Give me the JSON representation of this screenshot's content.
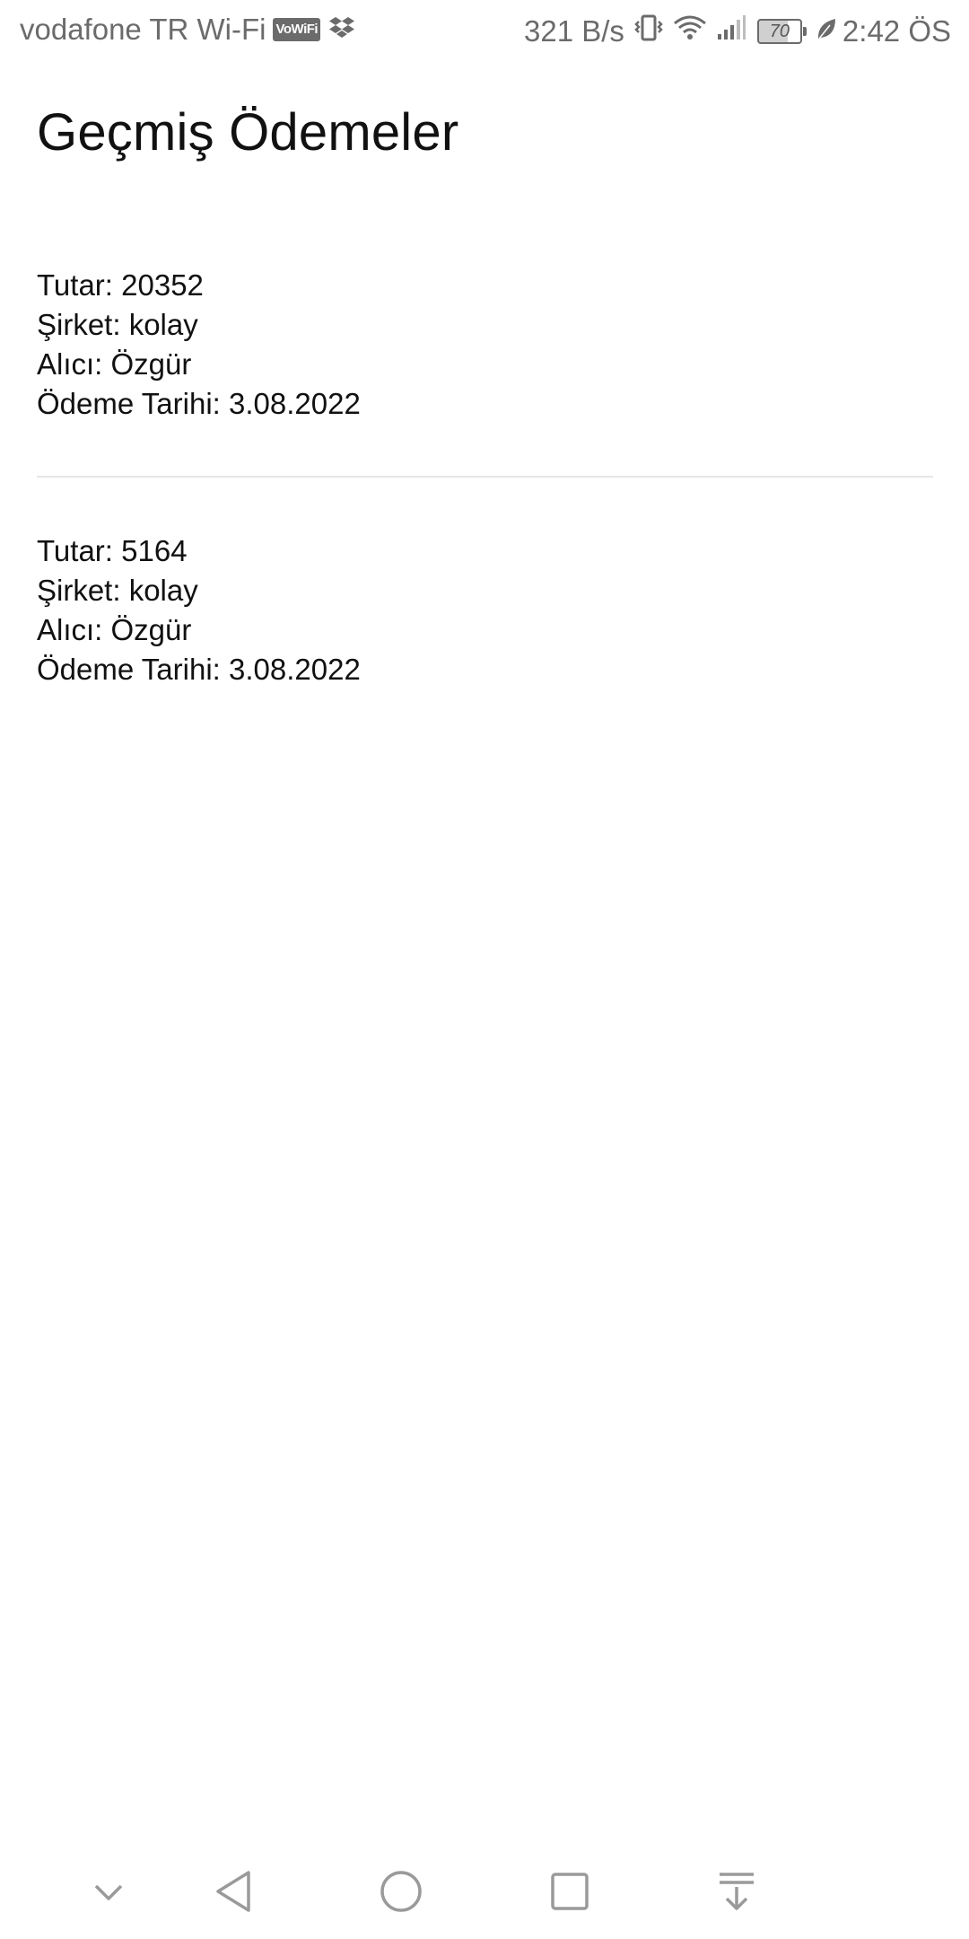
{
  "status_bar": {
    "carrier": "vodafone TR Wi-Fi",
    "vowifi_badge": "VoWiFi",
    "network_speed": "321 B/s",
    "battery_level": "70",
    "time": "2:42 ÖS",
    "icons": [
      "dropbox-icon",
      "vibrate-icon",
      "wifi-icon",
      "signal-icon",
      "battery-icon",
      "leaf-icon"
    ]
  },
  "page": {
    "title": "Geçmiş Ödemeler"
  },
  "payments": [
    {
      "amount": "Tutar: 20352",
      "company": "Şirket: kolay",
      "recipient": "Alıcı: Özgür",
      "date": "Ödeme Tarihi: 3.08.2022"
    },
    {
      "amount": "Tutar: 5164",
      "company": "Şirket: kolay",
      "recipient": "Alıcı: Özgür",
      "date": "Ödeme Tarihi: 3.08.2022"
    }
  ],
  "nav_bar": {
    "icons": [
      "chevron-down-icon",
      "back-icon",
      "home-icon",
      "recents-icon",
      "notification-pull-icon"
    ]
  },
  "colors": {
    "background": "#ffffff",
    "text": "#111111",
    "status_text": "#6b6b6b",
    "divider": "#e6e6e6",
    "nav_icon": "#9a9a9a"
  }
}
